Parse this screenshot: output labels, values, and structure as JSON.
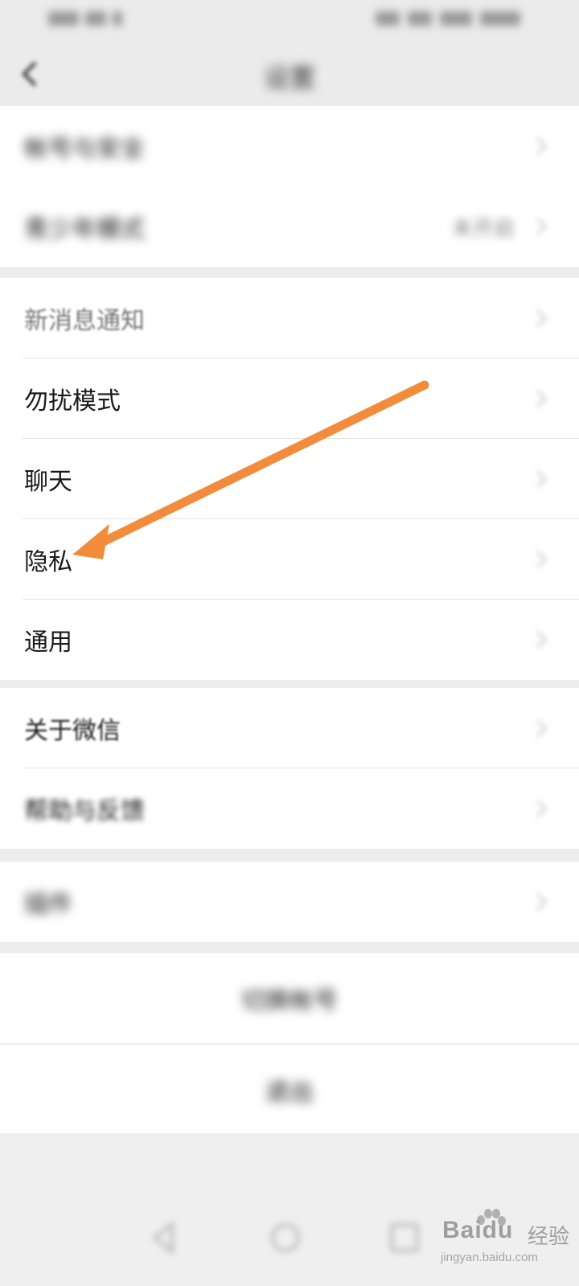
{
  "status_bar": {},
  "header": {
    "title": "设置"
  },
  "sections": {
    "account": [
      {
        "label": "帐号与安全"
      },
      {
        "label": "青少年模式",
        "value": "未开启"
      }
    ],
    "settings": [
      {
        "label": "新消息通知"
      },
      {
        "label": "勿扰模式"
      },
      {
        "label": "聊天"
      },
      {
        "label": "隐私"
      },
      {
        "label": "通用"
      }
    ],
    "about": [
      {
        "label": "关于微信"
      },
      {
        "label": "帮助与反馈"
      }
    ],
    "plugins": [
      {
        "label": "插件"
      }
    ]
  },
  "buttons": {
    "switch_account": "切换帐号",
    "logout": "退出"
  },
  "annotation": {
    "color": "#F28C3C"
  },
  "watermark": {
    "brand": "Baidu",
    "suffix": "经验",
    "url": "jingyan.baidu.com"
  }
}
